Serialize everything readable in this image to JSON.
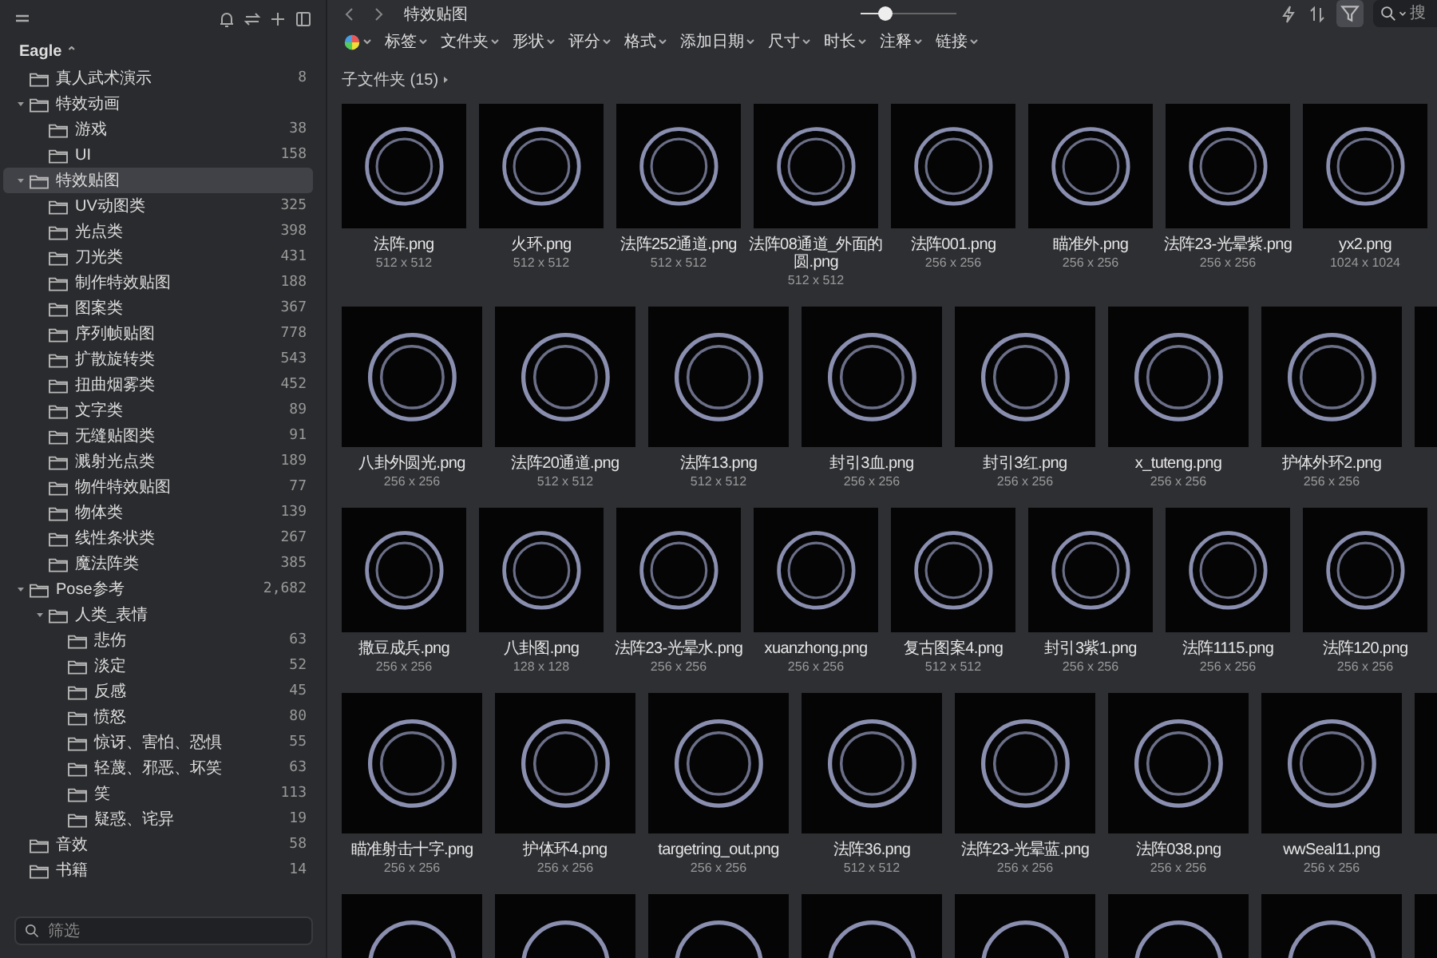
{
  "sidebar": {
    "library": "Eagle",
    "library_icon": "⌃",
    "folders": [
      {
        "name": "真人武术演示",
        "count": "8",
        "selected": false
      },
      {
        "name": "特效动画",
        "selected": false,
        "expanded": true,
        "children": [
          {
            "name": "游戏",
            "count": "38",
            "selected": false
          },
          {
            "name": "UI",
            "count": "158",
            "selected": false
          }
        ]
      },
      {
        "name": "特效贴图",
        "selected": true,
        "expanded": true,
        "children": [
          {
            "name": "UV动图类",
            "count": "325",
            "selected": false
          },
          {
            "name": "光点类",
            "count": "398",
            "selected": false
          },
          {
            "name": "刀光类",
            "count": "431",
            "selected": false
          },
          {
            "name": "制作特效贴图",
            "count": "188",
            "selected": false
          },
          {
            "name": "图案类",
            "count": "367",
            "selected": false
          },
          {
            "name": "序列帧贴图",
            "count": "778",
            "selected": false
          },
          {
            "name": "扩散旋转类",
            "count": "543",
            "selected": false
          },
          {
            "name": "扭曲烟雾类",
            "count": "452",
            "selected": false
          },
          {
            "name": "文字类",
            "count": "89",
            "selected": false
          },
          {
            "name": "无缝贴图类",
            "count": "91",
            "selected": false
          },
          {
            "name": "溅射光点类",
            "count": "189",
            "selected": false
          },
          {
            "name": "物件特效贴图",
            "count": "77",
            "selected": false
          },
          {
            "name": "物体类",
            "count": "139",
            "selected": false
          },
          {
            "name": "线性条状类",
            "count": "267",
            "selected": false
          },
          {
            "name": "魔法阵类",
            "count": "385",
            "selected": false
          }
        ]
      },
      {
        "name": "Pose参考",
        "count": "2,682",
        "selected": false,
        "expanded": true,
        "children": [
          {
            "name": "人类_表情",
            "selected": false,
            "expanded": true,
            "children": [
              {
                "name": "悲伤",
                "count": "63",
                "selected": false
              },
              {
                "name": "淡定",
                "count": "52",
                "selected": false
              },
              {
                "name": "反感",
                "count": "45",
                "selected": false
              },
              {
                "name": "愤怒",
                "count": "80",
                "selected": false
              },
              {
                "name": "惊讶、害怕、恐惧",
                "count": "55",
                "selected": false
              },
              {
                "name": "轻蔑、邪恶、坏笑",
                "count": "63",
                "selected": false
              },
              {
                "name": "笑",
                "count": "113",
                "selected": false
              },
              {
                "name": "疑惑、诧异",
                "count": "19",
                "selected": false
              }
            ]
          }
        ]
      },
      {
        "name": "音效",
        "count": "58",
        "selected": false
      },
      {
        "name": "书籍",
        "count": "14",
        "selected": false
      }
    ],
    "filter_placeholder": "筛选"
  },
  "toolbar": {
    "title": "特效贴图",
    "zoom": {
      "level": 0.25
    },
    "filter_active": true,
    "search_placeholder": "搜"
  },
  "filters": [
    "标签",
    "文件夹",
    "形状",
    "评分",
    "格式",
    "添加日期",
    "尺寸",
    "时长",
    "注释",
    "链接"
  ],
  "subfolders": "子文件夹 (15)",
  "rows": [
    {
      "items": [
        {
          "name": "法阵.png",
          "size": "512 x 512"
        },
        {
          "name": "火环.png",
          "size": "512 x 512"
        },
        {
          "name": "法阵252通道.png",
          "size": "512 x 512"
        },
        {
          "name": "法阵08通道_外面的圆.png",
          "size": "512 x 512"
        },
        {
          "name": "法阵001.png",
          "size": "256 x 256"
        },
        {
          "name": "瞄准外.png",
          "size": "256 x 256"
        },
        {
          "name": "法阵23-光晕紫.png",
          "size": "256 x 256"
        },
        {
          "name": "yx2.png",
          "size": "1024 x 1024"
        }
      ]
    },
    {
      "items": [
        {
          "name": "八卦外圆光.png",
          "size": "256 x 256"
        },
        {
          "name": "法阵20通道.png",
          "size": "512 x 512"
        },
        {
          "name": "法阵13.png",
          "size": "512 x 512"
        },
        {
          "name": "封引3血.png",
          "size": "256 x 256"
        },
        {
          "name": "封引3红.png",
          "size": "256 x 256"
        },
        {
          "name": "x_tuteng.png",
          "size": "256 x 256"
        },
        {
          "name": "护体外环2.png",
          "size": "256 x 256"
        }
      ]
    },
    {
      "items": [
        {
          "name": "撒豆成兵.png",
          "size": "256 x 256"
        },
        {
          "name": "八卦图.png",
          "size": "128 x 128"
        },
        {
          "name": "法阵23-光晕水.png",
          "size": "256 x 256"
        },
        {
          "name": "xuanzhong.png",
          "size": "256 x 256"
        },
        {
          "name": "复古图案4.png",
          "size": "512 x 512"
        },
        {
          "name": "封引3紫1.png",
          "size": "256 x 256"
        },
        {
          "name": "法阵1115.png",
          "size": "256 x 256"
        },
        {
          "name": "法阵120.png",
          "size": "256 x 256"
        }
      ]
    },
    {
      "items": [
        {
          "name": "瞄准射击十字.png",
          "size": "256 x 256"
        },
        {
          "name": "护体环4.png",
          "size": "256 x 256"
        },
        {
          "name": "targetring_out.png",
          "size": "256 x 256"
        },
        {
          "name": "法阵36.png",
          "size": "512 x 512"
        },
        {
          "name": "法阵23-光晕蓝.png",
          "size": "256 x 256"
        },
        {
          "name": "法阵038.png",
          "size": "256 x 256"
        },
        {
          "name": "wwSeal11.png",
          "size": "256 x 256"
        }
      ]
    }
  ]
}
